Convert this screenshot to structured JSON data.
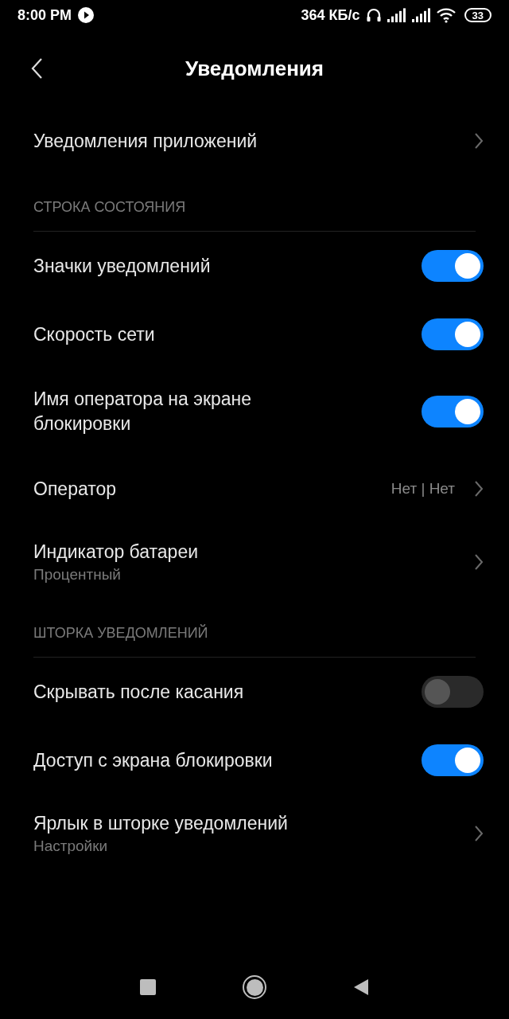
{
  "status_bar": {
    "time": "8:00 PM",
    "speed": "364 КБ/с",
    "battery": "33"
  },
  "title": "Уведомления",
  "groups": [
    {
      "items": [
        {
          "kind": "link",
          "label": "Уведомления приложений"
        }
      ]
    },
    {
      "header": "СТРОКА СОСТОЯНИЯ",
      "items": [
        {
          "kind": "toggle",
          "label": "Значки уведомлений",
          "on": true
        },
        {
          "kind": "toggle",
          "label": "Скорость сети",
          "on": true
        },
        {
          "kind": "toggle",
          "label": "Имя оператора на экране блокировки",
          "on": true
        },
        {
          "kind": "link",
          "label": "Оператор",
          "value": "Нет | Нет"
        },
        {
          "kind": "link",
          "label": "Индикатор батареи",
          "subtitle": "Процентный"
        }
      ]
    },
    {
      "header": "ШТОРКА УВЕДОМЛЕНИЙ",
      "items": [
        {
          "kind": "toggle",
          "label": "Скрывать после касания",
          "on": false
        },
        {
          "kind": "toggle",
          "label": "Доступ с экрана блокировки",
          "on": true
        },
        {
          "kind": "link",
          "label": "Ярлык в шторке уведомлений",
          "subtitle": "Настройки"
        }
      ]
    }
  ]
}
